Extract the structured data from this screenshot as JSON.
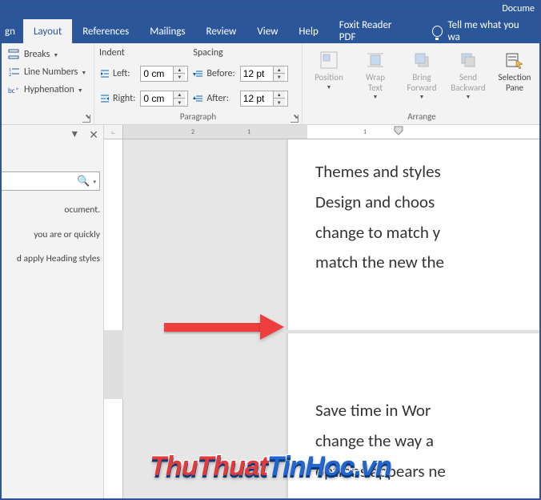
{
  "title": "Docume",
  "tabs": {
    "design_frag": "gn",
    "layout": "Layout",
    "references": "References",
    "mailings": "Mailings",
    "review": "Review",
    "view": "View",
    "help": "Help",
    "foxit": "Foxit Reader PDF",
    "tellme": "Tell me what you wa"
  },
  "page_setup": {
    "breaks": "Breaks",
    "line_numbers": "Line Numbers",
    "hyphenation": "Hyphenation"
  },
  "paragraph": {
    "group_label": "Paragraph",
    "indent_label": "Indent",
    "spacing_label": "Spacing",
    "left_label": "Left:",
    "right_label": "Right:",
    "before_label": "Before:",
    "after_label": "After:",
    "left_val": "0 cm",
    "right_val": "0 cm",
    "before_val": "12 pt",
    "after_val": "12 pt"
  },
  "arrange": {
    "group_label": "Arrange",
    "position": "Position",
    "wrap": "Wrap\nText",
    "bring": "Bring\nForward",
    "send": "Send\nBackward",
    "selection": "Selection\nPane"
  },
  "ruler_ticks": [
    "2",
    "1",
    "1"
  ],
  "nav": {
    "l1": "ocument.",
    "l2": "you are or quickly",
    "l3": "d apply Heading styles"
  },
  "doc": {
    "p1l1": "Themes and styles",
    "p1l2": "Design and choos",
    "p1l3": "change to match y",
    "p1l4": "match the new the",
    "p2l1": "Save time in Wor",
    "p2l2": "change the way a",
    "p2l3": "options appears ne"
  },
  "watermark": {
    "a": "ThuThuat",
    "b": "TinHoc.vn"
  }
}
